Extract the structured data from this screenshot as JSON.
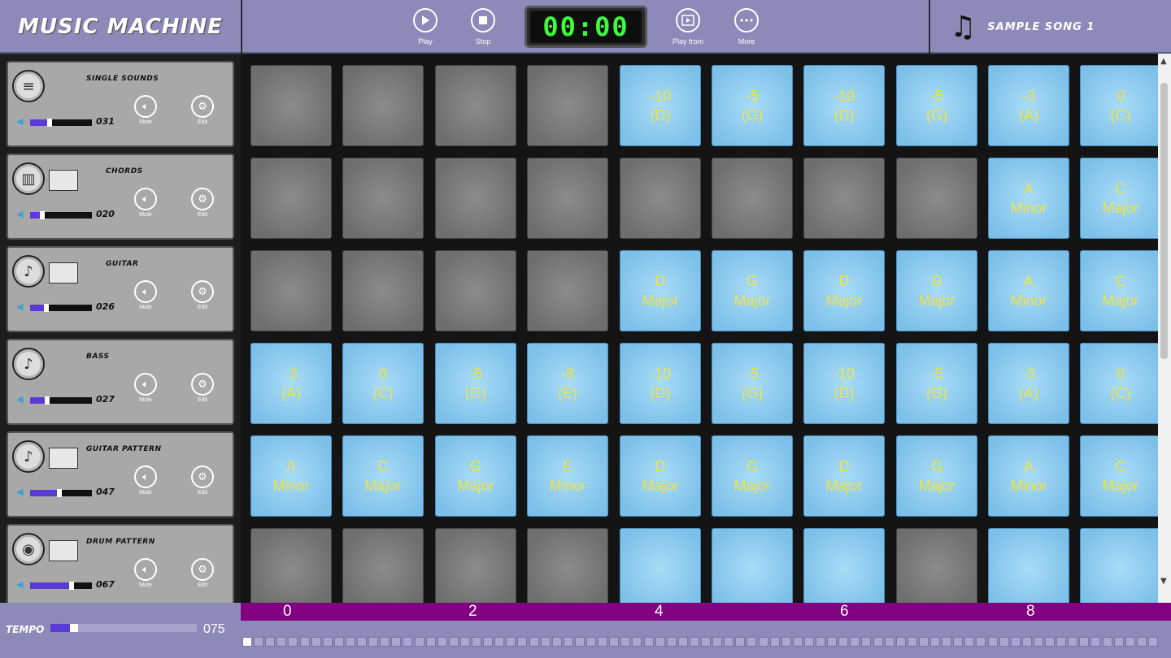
{
  "app": {
    "title": "MUSIC MACHINE"
  },
  "toolbar": {
    "play_label": "Play",
    "stop_label": "Stop",
    "play_from_label": "Play from",
    "more_label": "More",
    "timer": "00:00"
  },
  "song": {
    "name": "SAMPLE SONG 1"
  },
  "tracks": [
    {
      "name": "SINGLE SOUNDS",
      "volume": "031",
      "volume_fraction": 0.31,
      "mute_label": "Mute",
      "edit_label": "Edit",
      "icon": "sampler-icon"
    },
    {
      "name": "CHORDS",
      "volume": "020",
      "volume_fraction": 0.2,
      "mute_label": "Mute",
      "edit_label": "Edit",
      "icon": "keyboard-icon"
    },
    {
      "name": "GUITAR",
      "volume": "026",
      "volume_fraction": 0.26,
      "mute_label": "Mute",
      "edit_label": "Edit",
      "icon": "guitar-icon"
    },
    {
      "name": "BASS",
      "volume": "027",
      "volume_fraction": 0.27,
      "mute_label": "Mute",
      "edit_label": "Edit",
      "icon": "bass-icon"
    },
    {
      "name": "GUITAR PATTERN",
      "volume": "047",
      "volume_fraction": 0.47,
      "mute_label": "Mute",
      "edit_label": "Edit",
      "icon": "guitar-icon"
    },
    {
      "name": "DRUM PATTERN",
      "volume": "067",
      "volume_fraction": 0.67,
      "mute_label": "Mute",
      "edit_label": "Edit",
      "icon": "drum-icon"
    }
  ],
  "grid": [
    [
      null,
      null,
      null,
      null,
      [
        "-10",
        "(D)"
      ],
      [
        "-5",
        "(G)"
      ],
      [
        "-10",
        "(D)"
      ],
      [
        "-5",
        "(G)"
      ],
      [
        "-3",
        "(A)"
      ],
      [
        "0",
        "(C)"
      ]
    ],
    [
      null,
      null,
      null,
      null,
      null,
      null,
      null,
      null,
      [
        "A",
        "Minor"
      ],
      [
        "C",
        "Major"
      ]
    ],
    [
      null,
      null,
      null,
      null,
      [
        "D",
        "Major"
      ],
      [
        "G",
        "Major"
      ],
      [
        "D",
        "Major"
      ],
      [
        "G",
        "Major"
      ],
      [
        "A",
        "Minor"
      ],
      [
        "C",
        "Major"
      ]
    ],
    [
      [
        "-3",
        "(A)"
      ],
      [
        "0",
        "(C)"
      ],
      [
        "-5",
        "(G)"
      ],
      [
        "-8",
        "(E)"
      ],
      [
        "-10",
        "(D)"
      ],
      [
        "-5",
        "(G)"
      ],
      [
        "-10",
        "(D)"
      ],
      [
        "-5",
        "(G)"
      ],
      [
        "-3",
        "(A)"
      ],
      [
        "0",
        "(C)"
      ]
    ],
    [
      [
        "A",
        "Minor"
      ],
      [
        "C",
        "Major"
      ],
      [
        "G",
        "Major"
      ],
      [
        "E",
        "Minor"
      ],
      [
        "D",
        "Major"
      ],
      [
        "G",
        "Major"
      ],
      [
        "D",
        "Major"
      ],
      [
        "G",
        "Major"
      ],
      [
        "A",
        "Minor"
      ],
      [
        "C",
        "Major"
      ]
    ],
    [
      null,
      null,
      null,
      null,
      [
        "",
        ""
      ],
      [
        "",
        ""
      ],
      [
        "",
        ""
      ],
      null,
      [
        "",
        ""
      ],
      [
        "",
        ""
      ]
    ]
  ],
  "tempo": {
    "label": "TEMPO",
    "value": "075",
    "fraction": 0.16
  },
  "beats": [
    "0",
    "2",
    "4",
    "6",
    "8"
  ],
  "colors": {
    "accent": "#8d89b8",
    "beat_bar": "#820082",
    "pad_on": "#7cbfe8",
    "pad_text": "#ede24a",
    "timer_digits": "#3bff3b"
  }
}
